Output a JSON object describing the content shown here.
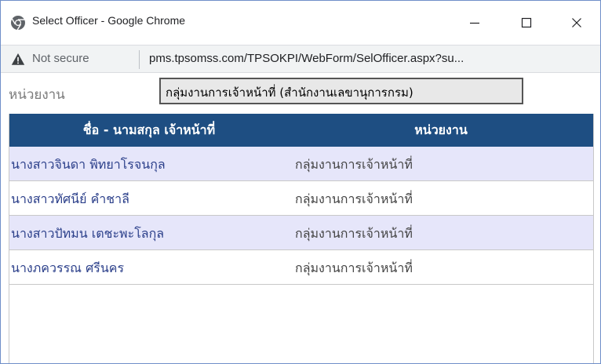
{
  "window": {
    "title": "Select Officer - Google Chrome"
  },
  "address_bar": {
    "security_label": "Not secure",
    "url": "pms.tpsomss.com/TPSOKPI/WebForm/SelOfficer.aspx?su..."
  },
  "filter": {
    "label": "หน่วยงาน",
    "value": "กลุ่มงานการเจ้าหน้าที่ (สำนักงานเลขานุการกรม)"
  },
  "grid": {
    "columns": [
      "ชื่อ - นามสกุล เจ้าหน้าที่",
      "หน่วยงาน"
    ],
    "rows": [
      {
        "name": "นางสาวจินดา พิทยาโรจนกุล",
        "unit": "กลุ่มงานการเจ้าหน้าที่"
      },
      {
        "name": "นางสาวทัศนีย์ คำชาลี",
        "unit": "กลุ่มงานการเจ้าหน้าที่"
      },
      {
        "name": "นางสาวปัทมน เตชะพะโลกุล",
        "unit": "กลุ่มงานการเจ้าหน้าที่"
      },
      {
        "name": "นางภควรรณ ศรีนคร",
        "unit": "กลุ่มงานการเจ้าหน้าที่"
      }
    ]
  },
  "colors": {
    "header_bg": "#1e4e82",
    "row_alt_bg": "#e6e6fa",
    "name_text": "#2b3f8a"
  },
  "icons": {
    "app": "chrome-icon",
    "security": "warning-icon",
    "minimize": "minimize-icon",
    "maximize": "maximize-icon",
    "close": "close-icon"
  }
}
